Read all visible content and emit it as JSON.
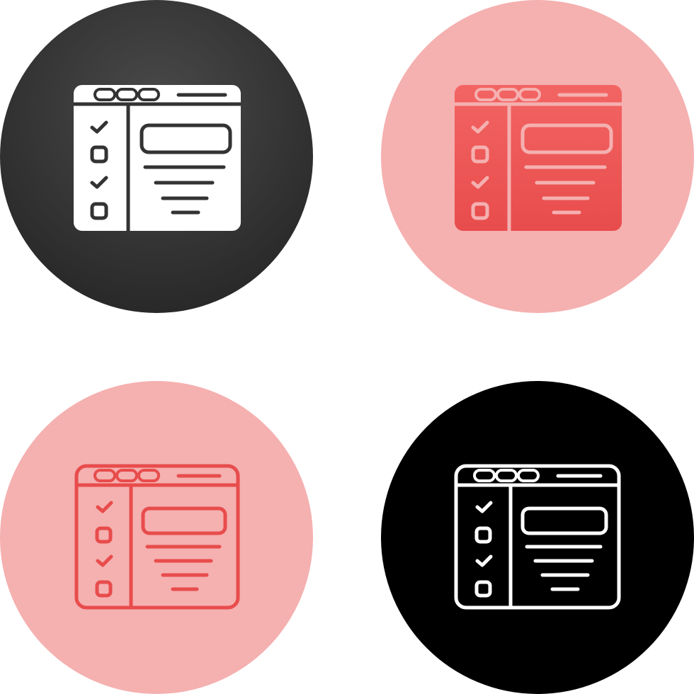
{
  "icons": [
    {
      "name": "browser-checklist-icon",
      "style": "glyph",
      "circle_gradient": [
        "#4a4a4a",
        "#262626"
      ],
      "window_color": "#ffffff",
      "detail_color": "#333333"
    },
    {
      "name": "browser-checklist-icon",
      "style": "glyph",
      "circle_gradient": [
        "#f5b0b0",
        "#f5b0b0"
      ],
      "window_gradient": [
        "#f26563",
        "#e84c4c"
      ],
      "detail_color": "#f5b0b0"
    },
    {
      "name": "browser-checklist-icon",
      "style": "outline",
      "circle_gradient": [
        "#f5b0b0",
        "#f5b0b0"
      ],
      "stroke_color": "#e84c4c"
    },
    {
      "name": "browser-checklist-icon",
      "style": "outline",
      "circle_gradient": [
        "#000000",
        "#000000"
      ],
      "stroke_color": "#ffffff"
    }
  ]
}
